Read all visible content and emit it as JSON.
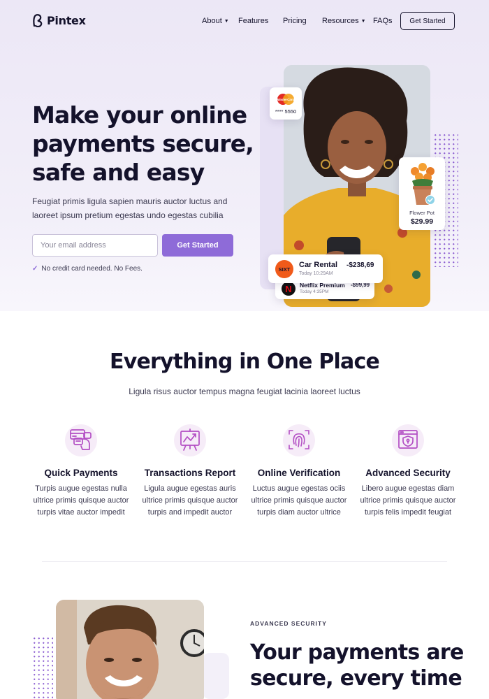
{
  "brand": {
    "name": "Pintex",
    "accent": "#8e6bd8",
    "dark": "#14122b"
  },
  "nav": {
    "items": [
      {
        "label": "About",
        "caret": true
      },
      {
        "label": "Features",
        "caret": false
      },
      {
        "label": "Pricing",
        "caret": false
      },
      {
        "label": "Resources",
        "caret": true
      },
      {
        "label": "FAQs",
        "caret": false
      }
    ],
    "cta": "Get Started"
  },
  "hero": {
    "title": "Make your online payments secure, safe and easy",
    "subtitle": "Feugiat primis ligula sapien mauris auctor luctus and laoreet ipsum pretium egestas undo egestas cubilia",
    "email_placeholder": "Your email address",
    "cta": "Get Started",
    "note": "No credit card needed. No Fees.",
    "card_brand": "MasterCard",
    "card_number": "**** 5550",
    "product": {
      "name": "Flower Pot",
      "price": "$29.99"
    },
    "transactions": [
      {
        "logo": "SIXT",
        "name": "Car Rental",
        "time": "Today 10:29AM",
        "amount": "-$238,69"
      },
      {
        "logo": "N",
        "name": "Netflix Premium",
        "time": "Today 4:35PM",
        "amount": "-$99,99"
      }
    ]
  },
  "features_section": {
    "title": "Everything in One Place",
    "subtitle": "Ligula risus auctor tempus magna feugiat lacinia laoreet luctus",
    "items": [
      {
        "icon": "payments-icon",
        "title": "Quick Payments",
        "desc": "Turpis augue egestas nulla ultrice primis quisque auctor turpis vitae auctor impedit"
      },
      {
        "icon": "report-chart-icon",
        "title": "Transactions Report",
        "desc": "Ligula augue egestas auris ultrice primis quisque auctor turpis and impedit auctor"
      },
      {
        "icon": "fingerprint-icon",
        "title": "Online Verification",
        "desc": "Luctus augue egestas ociis ultrice primis quisque auctor turpis diam auctor ultrice"
      },
      {
        "icon": "security-shield-icon",
        "title": "Advanced Security",
        "desc": "Libero augue egestas diam ultrice primis quisque auctor turpis felis impedit feugiat"
      }
    ]
  },
  "security_section": {
    "eyebrow": "ADVANCED SECURITY",
    "title": "Your payments are secure, every time"
  }
}
